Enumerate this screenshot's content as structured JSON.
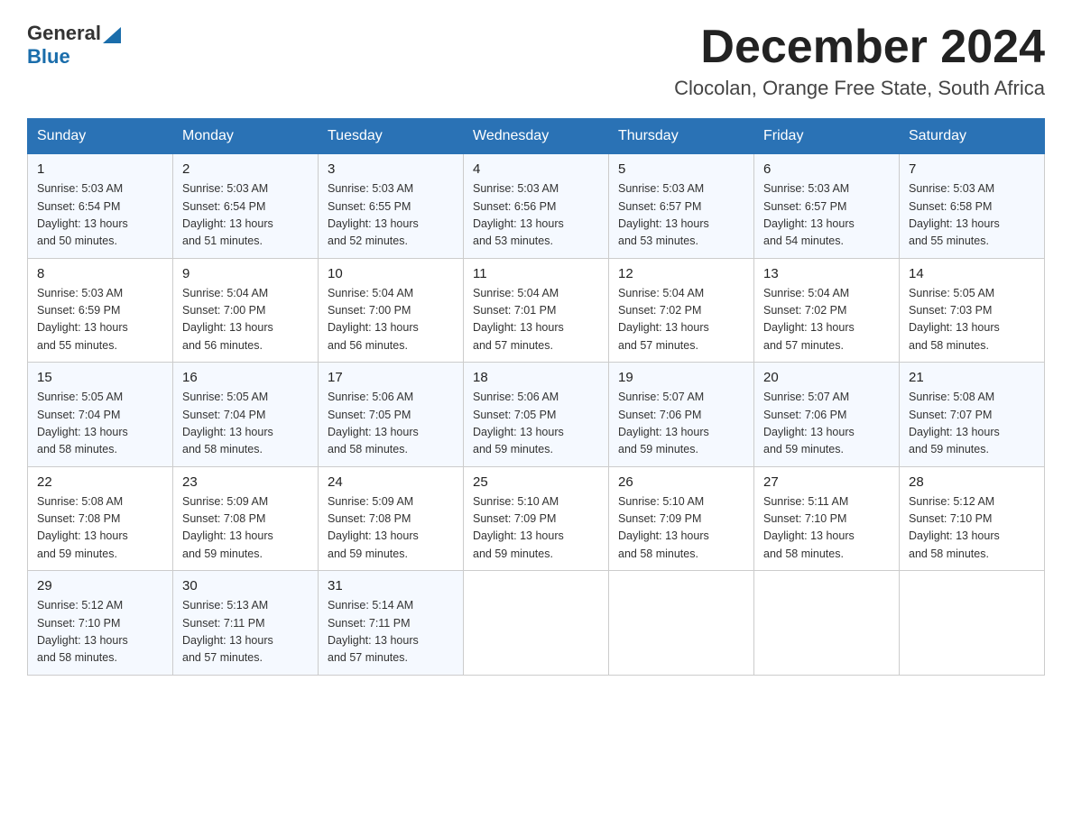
{
  "header": {
    "logo_general": "General",
    "logo_blue": "Blue",
    "month_year": "December 2024",
    "location": "Clocolan, Orange Free State, South Africa"
  },
  "days_of_week": [
    "Sunday",
    "Monday",
    "Tuesday",
    "Wednesday",
    "Thursday",
    "Friday",
    "Saturday"
  ],
  "weeks": [
    [
      {
        "date": "1",
        "sunrise": "5:03 AM",
        "sunset": "6:54 PM",
        "daylight_hours": "13",
        "daylight_minutes": "50"
      },
      {
        "date": "2",
        "sunrise": "5:03 AM",
        "sunset": "6:54 PM",
        "daylight_hours": "13",
        "daylight_minutes": "51"
      },
      {
        "date": "3",
        "sunrise": "5:03 AM",
        "sunset": "6:55 PM",
        "daylight_hours": "13",
        "daylight_minutes": "52"
      },
      {
        "date": "4",
        "sunrise": "5:03 AM",
        "sunset": "6:56 PM",
        "daylight_hours": "13",
        "daylight_minutes": "53"
      },
      {
        "date": "5",
        "sunrise": "5:03 AM",
        "sunset": "6:57 PM",
        "daylight_hours": "13",
        "daylight_minutes": "53"
      },
      {
        "date": "6",
        "sunrise": "5:03 AM",
        "sunset": "6:57 PM",
        "daylight_hours": "13",
        "daylight_minutes": "54"
      },
      {
        "date": "7",
        "sunrise": "5:03 AM",
        "sunset": "6:58 PM",
        "daylight_hours": "13",
        "daylight_minutes": "55"
      }
    ],
    [
      {
        "date": "8",
        "sunrise": "5:03 AM",
        "sunset": "6:59 PM",
        "daylight_hours": "13",
        "daylight_minutes": "55"
      },
      {
        "date": "9",
        "sunrise": "5:04 AM",
        "sunset": "7:00 PM",
        "daylight_hours": "13",
        "daylight_minutes": "56"
      },
      {
        "date": "10",
        "sunrise": "5:04 AM",
        "sunset": "7:00 PM",
        "daylight_hours": "13",
        "daylight_minutes": "56"
      },
      {
        "date": "11",
        "sunrise": "5:04 AM",
        "sunset": "7:01 PM",
        "daylight_hours": "13",
        "daylight_minutes": "57"
      },
      {
        "date": "12",
        "sunrise": "5:04 AM",
        "sunset": "7:02 PM",
        "daylight_hours": "13",
        "daylight_minutes": "57"
      },
      {
        "date": "13",
        "sunrise": "5:04 AM",
        "sunset": "7:02 PM",
        "daylight_hours": "13",
        "daylight_minutes": "57"
      },
      {
        "date": "14",
        "sunrise": "5:05 AM",
        "sunset": "7:03 PM",
        "daylight_hours": "13",
        "daylight_minutes": "58"
      }
    ],
    [
      {
        "date": "15",
        "sunrise": "5:05 AM",
        "sunset": "7:04 PM",
        "daylight_hours": "13",
        "daylight_minutes": "58"
      },
      {
        "date": "16",
        "sunrise": "5:05 AM",
        "sunset": "7:04 PM",
        "daylight_hours": "13",
        "daylight_minutes": "58"
      },
      {
        "date": "17",
        "sunrise": "5:06 AM",
        "sunset": "7:05 PM",
        "daylight_hours": "13",
        "daylight_minutes": "58"
      },
      {
        "date": "18",
        "sunrise": "5:06 AM",
        "sunset": "7:05 PM",
        "daylight_hours": "13",
        "daylight_minutes": "59"
      },
      {
        "date": "19",
        "sunrise": "5:07 AM",
        "sunset": "7:06 PM",
        "daylight_hours": "13",
        "daylight_minutes": "59"
      },
      {
        "date": "20",
        "sunrise": "5:07 AM",
        "sunset": "7:06 PM",
        "daylight_hours": "13",
        "daylight_minutes": "59"
      },
      {
        "date": "21",
        "sunrise": "5:08 AM",
        "sunset": "7:07 PM",
        "daylight_hours": "13",
        "daylight_minutes": "59"
      }
    ],
    [
      {
        "date": "22",
        "sunrise": "5:08 AM",
        "sunset": "7:08 PM",
        "daylight_hours": "13",
        "daylight_minutes": "59"
      },
      {
        "date": "23",
        "sunrise": "5:09 AM",
        "sunset": "7:08 PM",
        "daylight_hours": "13",
        "daylight_minutes": "59"
      },
      {
        "date": "24",
        "sunrise": "5:09 AM",
        "sunset": "7:08 PM",
        "daylight_hours": "13",
        "daylight_minutes": "59"
      },
      {
        "date": "25",
        "sunrise": "5:10 AM",
        "sunset": "7:09 PM",
        "daylight_hours": "13",
        "daylight_minutes": "59"
      },
      {
        "date": "26",
        "sunrise": "5:10 AM",
        "sunset": "7:09 PM",
        "daylight_hours": "13",
        "daylight_minutes": "58"
      },
      {
        "date": "27",
        "sunrise": "5:11 AM",
        "sunset": "7:10 PM",
        "daylight_hours": "13",
        "daylight_minutes": "58"
      },
      {
        "date": "28",
        "sunrise": "5:12 AM",
        "sunset": "7:10 PM",
        "daylight_hours": "13",
        "daylight_minutes": "58"
      }
    ],
    [
      {
        "date": "29",
        "sunrise": "5:12 AM",
        "sunset": "7:10 PM",
        "daylight_hours": "13",
        "daylight_minutes": "58"
      },
      {
        "date": "30",
        "sunrise": "5:13 AM",
        "sunset": "7:11 PM",
        "daylight_hours": "13",
        "daylight_minutes": "57"
      },
      {
        "date": "31",
        "sunrise": "5:14 AM",
        "sunset": "7:11 PM",
        "daylight_hours": "13",
        "daylight_minutes": "57"
      },
      null,
      null,
      null,
      null
    ]
  ]
}
